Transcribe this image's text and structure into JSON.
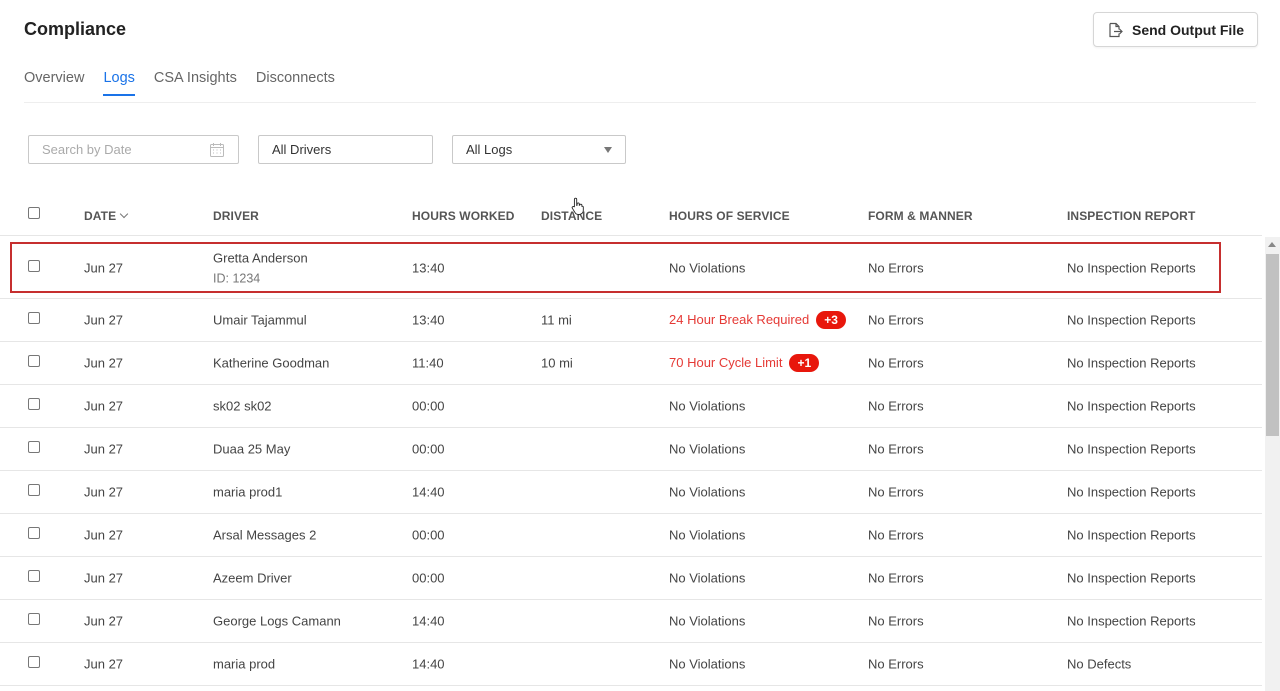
{
  "page": {
    "title": "Compliance"
  },
  "toolbar": {
    "send_label": "Send Output File",
    "send_icon": "file-export-icon"
  },
  "tabs": [
    {
      "label": "Overview",
      "active": false
    },
    {
      "label": "Logs",
      "active": true
    },
    {
      "label": "CSA Insights",
      "active": false
    },
    {
      "label": "Disconnects",
      "active": false
    }
  ],
  "filters": {
    "date_placeholder": "Search by Date",
    "drivers_value": "All Drivers",
    "logs_value": "All Logs"
  },
  "table": {
    "headers": {
      "date": "DATE",
      "driver": "DRIVER",
      "hours_worked": "HOURS WORKED",
      "distance": "DISTANCE",
      "hours_of_service": "HOURS OF SERVICE",
      "form_manner": "FORM & MANNER",
      "inspection_report": "INSPECTION REPORT"
    },
    "rows": [
      {
        "date": "Jun 27",
        "driver": "Gretta Anderson",
        "driver_id": "ID: 1234",
        "hours": "13:40",
        "distance": "",
        "hos": "No Violations",
        "hos_badge": "",
        "form": "No Errors",
        "inspection": "No Inspection Reports"
      },
      {
        "date": "Jun 27",
        "driver": "Umair Tajammul",
        "driver_id": "",
        "hours": "13:40",
        "distance": "11 mi",
        "hos": "24 Hour Break Required",
        "hos_badge": "+3",
        "form": "No Errors",
        "inspection": "No Inspection Reports"
      },
      {
        "date": "Jun 27",
        "driver": "Katherine Goodman",
        "driver_id": "",
        "hours": "11:40",
        "distance": "10 mi",
        "hos": "70 Hour Cycle Limit",
        "hos_badge": "+1",
        "form": "No Errors",
        "inspection": "No Inspection Reports"
      },
      {
        "date": "Jun 27",
        "driver": "sk02 sk02",
        "driver_id": "",
        "hours": "00:00",
        "distance": "",
        "hos": "No Violations",
        "hos_badge": "",
        "form": "No Errors",
        "inspection": "No Inspection Reports"
      },
      {
        "date": "Jun 27",
        "driver": "Duaa 25 May",
        "driver_id": "",
        "hours": "00:00",
        "distance": "",
        "hos": "No Violations",
        "hos_badge": "",
        "form": "No Errors",
        "inspection": "No Inspection Reports"
      },
      {
        "date": "Jun 27",
        "driver": "maria prod1",
        "driver_id": "",
        "hours": "14:40",
        "distance": "",
        "hos": "No Violations",
        "hos_badge": "",
        "form": "No Errors",
        "inspection": "No Inspection Reports"
      },
      {
        "date": "Jun 27",
        "driver": "Arsal Messages 2",
        "driver_id": "",
        "hours": "00:00",
        "distance": "",
        "hos": "No Violations",
        "hos_badge": "",
        "form": "No Errors",
        "inspection": "No Inspection Reports"
      },
      {
        "date": "Jun 27",
        "driver": "Azeem Driver",
        "driver_id": "",
        "hours": "00:00",
        "distance": "",
        "hos": "No Violations",
        "hos_badge": "",
        "form": "No Errors",
        "inspection": "No Inspection Reports"
      },
      {
        "date": "Jun 27",
        "driver": "George Logs Camann",
        "driver_id": "",
        "hours": "14:40",
        "distance": "",
        "hos": "No Violations",
        "hos_badge": "",
        "form": "No Errors",
        "inspection": "No Inspection Reports"
      },
      {
        "date": "Jun 27",
        "driver": "maria prod",
        "driver_id": "",
        "hours": "14:40",
        "distance": "",
        "hos": "No Violations",
        "hos_badge": "",
        "form": "No Errors",
        "inspection": "No Defects"
      }
    ]
  },
  "colors": {
    "accent": "#1a73e8",
    "violation": "#e53935",
    "badge": "#e8170c",
    "highlight": "#c62f2f"
  }
}
